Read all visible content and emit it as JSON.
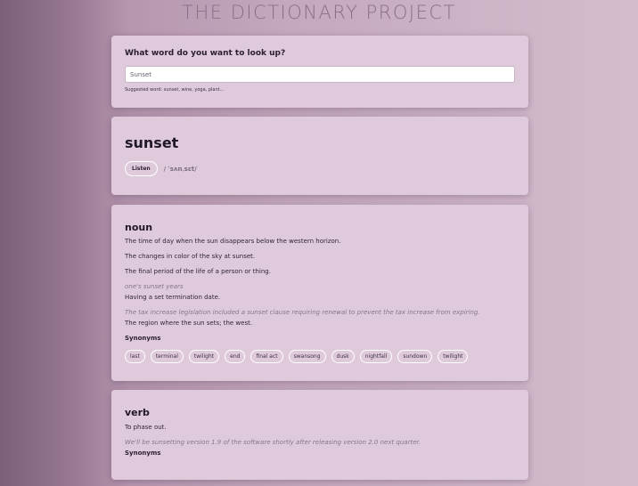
{
  "site": {
    "title": "THE DICTIONARY PROJECT"
  },
  "search": {
    "question": "What word do you want to look up?",
    "value": "Sunset",
    "suggestion": "Suggested word: sunset, wine, yoga, plant..."
  },
  "word": {
    "headword": "sunset",
    "listen_label": "Listen",
    "phonetic": "/ ˈsʌnˌsɛt/"
  },
  "noun": {
    "part_of_speech": "noun",
    "definitions": [
      "The time of day when the sun disappears below the western horizon.",
      "The changes in color of the sky at sunset.",
      "The final period of the life of a person or thing."
    ],
    "example_1": "one's sunset years",
    "definition_4": "Having a set termination date.",
    "example_2": "The tax increase legislation included a sunset clause requiring renewal to prevent the tax increase from expiring.",
    "definition_5": "The region where the sun sets; the west.",
    "synonyms_title": "Synonyms",
    "synonyms": [
      "last",
      "terminal",
      "twilight",
      "end",
      "final act",
      "swansong",
      "dusk",
      "nightfall",
      "sundown",
      "twilight"
    ]
  },
  "verb": {
    "part_of_speech": "verb",
    "definition": "To phase out.",
    "example": "We'll be sunsetting version 1.9 of the software shortly after releasing version 2.0 next quarter.",
    "synonyms_title": "Synonyms"
  }
}
